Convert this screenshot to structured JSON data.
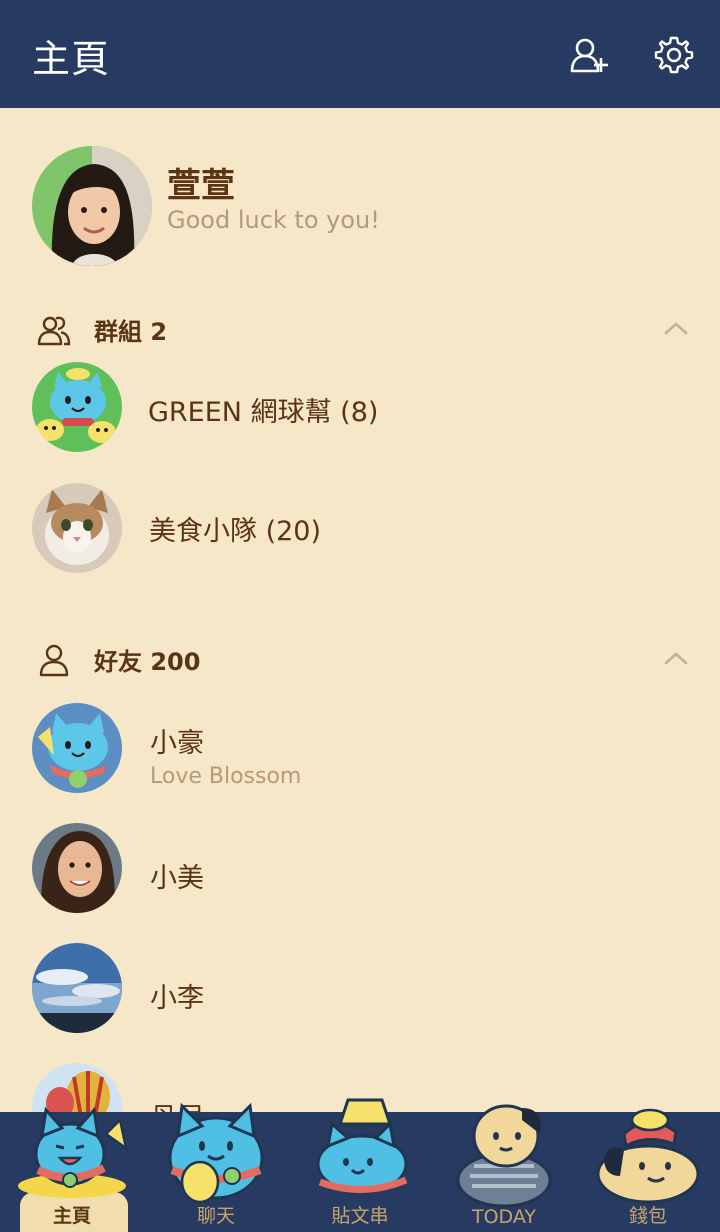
{
  "header": {
    "title": "主頁",
    "add_friend_icon": "add-friend-icon",
    "settings_icon": "gear-icon"
  },
  "profile": {
    "name": "萱萱",
    "status": "Good luck to you!"
  },
  "groups": {
    "label": "群組 2",
    "items": [
      {
        "name": "GREEN 網球幫 (8)"
      },
      {
        "name": "美食小隊 (20)"
      }
    ]
  },
  "friends": {
    "label": "好友 200",
    "items": [
      {
        "name": "小豪",
        "status": "Love Blossom"
      },
      {
        "name": "小美"
      },
      {
        "name": "小李"
      },
      {
        "name": "丹尼"
      }
    ]
  },
  "tabs": [
    {
      "label": "主頁"
    },
    {
      "label": "聊天"
    },
    {
      "label": "貼文串"
    },
    {
      "label": "TODAY"
    },
    {
      "label": "錢包"
    }
  ],
  "colors": {
    "header_bg": "#273a62",
    "page_bg": "#f6e7c8",
    "text_brown": "#5a3413",
    "muted_text": "#b59a79",
    "tab_text": "#c8a46a"
  }
}
